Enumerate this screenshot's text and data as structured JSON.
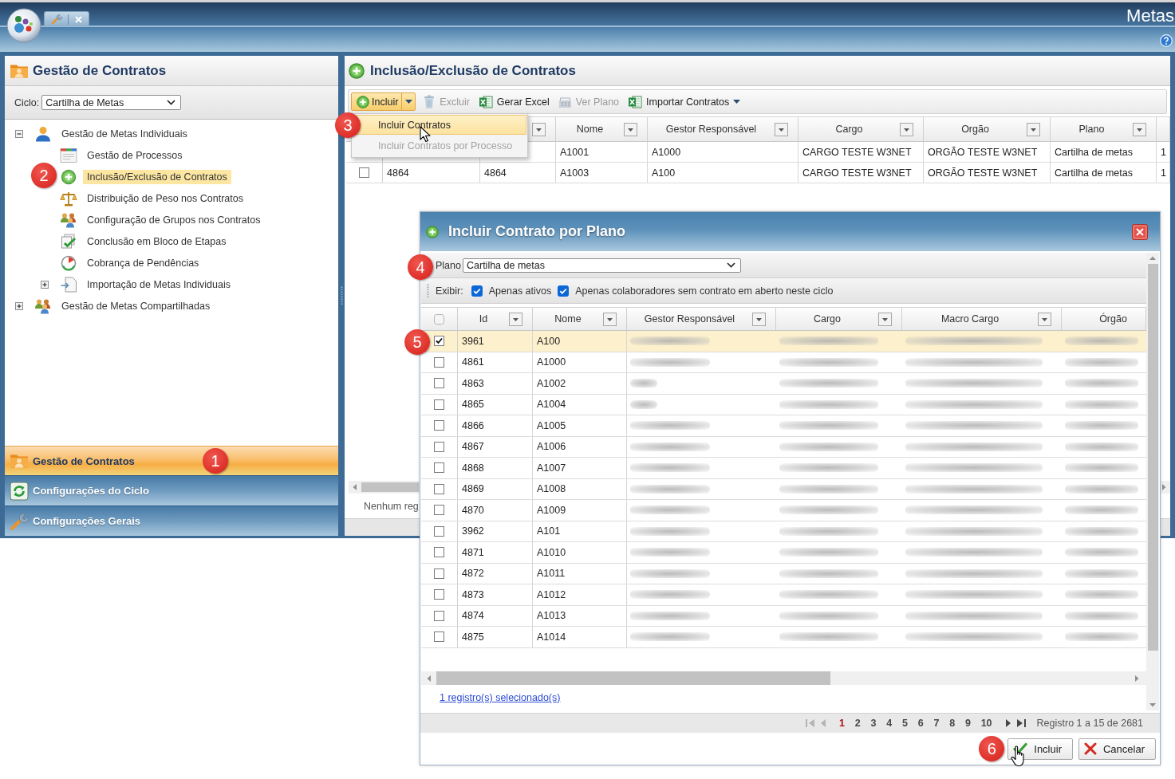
{
  "app": {
    "title": "Metas"
  },
  "left_panel": {
    "title": "Gestão de Contratos",
    "cycle": {
      "label": "Ciclo:",
      "value": "Cartilha de Metas"
    },
    "tree": [
      {
        "label": "Gestão de Metas Individuais",
        "selected": false,
        "expanded": true,
        "children": [
          {
            "label": "Gestão de Processos",
            "selected": false
          },
          {
            "label": "Inclusão/Exclusão de Contratos",
            "selected": true,
            "callout": "2"
          },
          {
            "label": "Distribuição de Peso nos Contratos",
            "selected": false
          },
          {
            "label": "Configuração de Grupos nos Contratos",
            "selected": false
          },
          {
            "label": "Conclusão em Bloco de Etapas",
            "selected": false
          },
          {
            "label": "Cobrança de Pendências",
            "selected": false
          },
          {
            "label": "Importação de Metas Individuais",
            "selected": false,
            "expanded": false
          }
        ]
      },
      {
        "label": "Gestão de Metas Compartilhadas",
        "selected": false,
        "expanded": false
      }
    ],
    "sections": [
      {
        "label": "Gestão de Contratos",
        "selected": true,
        "callout": "1"
      },
      {
        "label": "Configurações do Ciclo",
        "selected": false
      },
      {
        "label": "Configurações Gerais",
        "selected": false
      }
    ]
  },
  "main_panel": {
    "title": "Inclusão/Exclusão de Contratos",
    "toolbar": [
      {
        "kind": "split",
        "label": "Incluir",
        "disabled": false,
        "open": true,
        "menu": [
          {
            "label": "Incluir Contratos",
            "selected": true,
            "disabled": false,
            "callout": "3"
          },
          {
            "label": "Incluir Contratos por Processo",
            "selected": false,
            "disabled": true
          }
        ]
      },
      {
        "kind": "button",
        "label": "Excluir",
        "disabled": true
      },
      {
        "kind": "button",
        "label": "Gerar Excel",
        "disabled": false
      },
      {
        "kind": "button",
        "label": "Ver Plano",
        "disabled": true
      },
      {
        "kind": "menu",
        "label": "Importar Contratos",
        "disabled": false
      }
    ],
    "grid": {
      "columns": [
        {},
        {
          "filter": true
        },
        {
          "label": "Nome",
          "filter": true
        },
        {
          "label": "Gestor Responsável",
          "filter": true
        },
        {
          "label": "Cargo",
          "filter": true
        },
        {
          "label": "Orgão",
          "filter": true
        },
        {
          "label": "Plano",
          "filter": true
        },
        {}
      ],
      "rows": [
        {
          "cells": [
            null,
            null,
            "A1001",
            "A1000",
            "CARGO TESTE W3NET",
            "ORGÃO TESTE W3NET",
            "Cartilha de metas",
            "1"
          ]
        },
        {
          "checked": false,
          "cells": [
            "4864",
            "4864",
            "A1003",
            "A100",
            "CARGO TESTE W3NET",
            "ORGÃO TESTE W3NET",
            "Cartilha de metas",
            "1"
          ]
        }
      ]
    },
    "status": "Nenhum reg"
  },
  "dialog": {
    "title": "Incluir Contrato por Plano",
    "plan": {
      "label": "Plano",
      "value": "Cartilha de metas",
      "callout": "4"
    },
    "filters": {
      "label": "Exibir:",
      "options": [
        {
          "label": "Apenas ativos",
          "checked": true
        },
        {
          "label": "Apenas colaboradores sem contrato em aberto neste ciclo",
          "checked": true
        }
      ]
    },
    "grid": {
      "select_all_checked": false,
      "columns": [
        {
          "label": "Id",
          "filter": true,
          "blurred": false
        },
        {
          "label": "Nome",
          "filter": true,
          "blurred": false
        },
        {
          "label": "Gestor Responsável",
          "filter": true,
          "blurred": true
        },
        {
          "label": "Cargo",
          "filter": true,
          "blurred": true
        },
        {
          "label": "Macro Cargo",
          "filter": true,
          "blurred": true
        },
        {
          "label": "Órgão",
          "filter": false,
          "blurred": true
        }
      ],
      "rows": [
        {
          "checked": true,
          "selected": true,
          "callout": "5",
          "cells": [
            "3961",
            "A100"
          ]
        },
        {
          "checked": false,
          "selected": false,
          "cells": [
            "4861",
            "A1000"
          ]
        },
        {
          "checked": false,
          "selected": false,
          "cells": [
            "4863",
            "A1002"
          ]
        },
        {
          "checked": false,
          "selected": false,
          "cells": [
            "4865",
            "A1004"
          ]
        },
        {
          "checked": false,
          "selected": false,
          "cells": [
            "4866",
            "A1005"
          ]
        },
        {
          "checked": false,
          "selected": false,
          "cells": [
            "4867",
            "A1006"
          ]
        },
        {
          "checked": false,
          "selected": false,
          "cells": [
            "4868",
            "A1007"
          ]
        },
        {
          "checked": false,
          "selected": false,
          "cells": [
            "4869",
            "A1008"
          ]
        },
        {
          "checked": false,
          "selected": false,
          "cells": [
            "4870",
            "A1009"
          ]
        },
        {
          "checked": false,
          "selected": false,
          "cells": [
            "3962",
            "A101"
          ]
        },
        {
          "checked": false,
          "selected": false,
          "cells": [
            "4871",
            "A1010"
          ]
        },
        {
          "checked": false,
          "selected": false,
          "cells": [
            "4872",
            "A1011"
          ]
        },
        {
          "checked": false,
          "selected": false,
          "cells": [
            "4873",
            "A1012"
          ]
        },
        {
          "checked": false,
          "selected": false,
          "cells": [
            "4874",
            "A1013"
          ]
        },
        {
          "checked": false,
          "selected": false,
          "cells": [
            "4875",
            "A1014"
          ]
        }
      ]
    },
    "selection_link": "1 registro(s) selecionado(s)",
    "pager": {
      "nav": [
        {
          "kind": "first",
          "disabled": true
        },
        {
          "kind": "previous",
          "disabled": true
        },
        {
          "kind": "next",
          "disabled": false
        },
        {
          "kind": "last",
          "disabled": false
        }
      ],
      "pages": [
        {
          "label": "1",
          "selected": true
        },
        {
          "label": "2",
          "selected": false
        },
        {
          "label": "3",
          "selected": false
        },
        {
          "label": "4",
          "selected": false
        },
        {
          "label": "5",
          "selected": false
        },
        {
          "label": "6",
          "selected": false
        },
        {
          "label": "7",
          "selected": false
        },
        {
          "label": "8",
          "selected": false
        },
        {
          "label": "9",
          "selected": false
        },
        {
          "label": "10",
          "selected": false
        }
      ],
      "summary": "Registro 1 a 15 de 2681"
    },
    "buttons": [
      {
        "label": "Incluir",
        "callout": "6"
      },
      {
        "label": "Cancelar"
      }
    ]
  }
}
